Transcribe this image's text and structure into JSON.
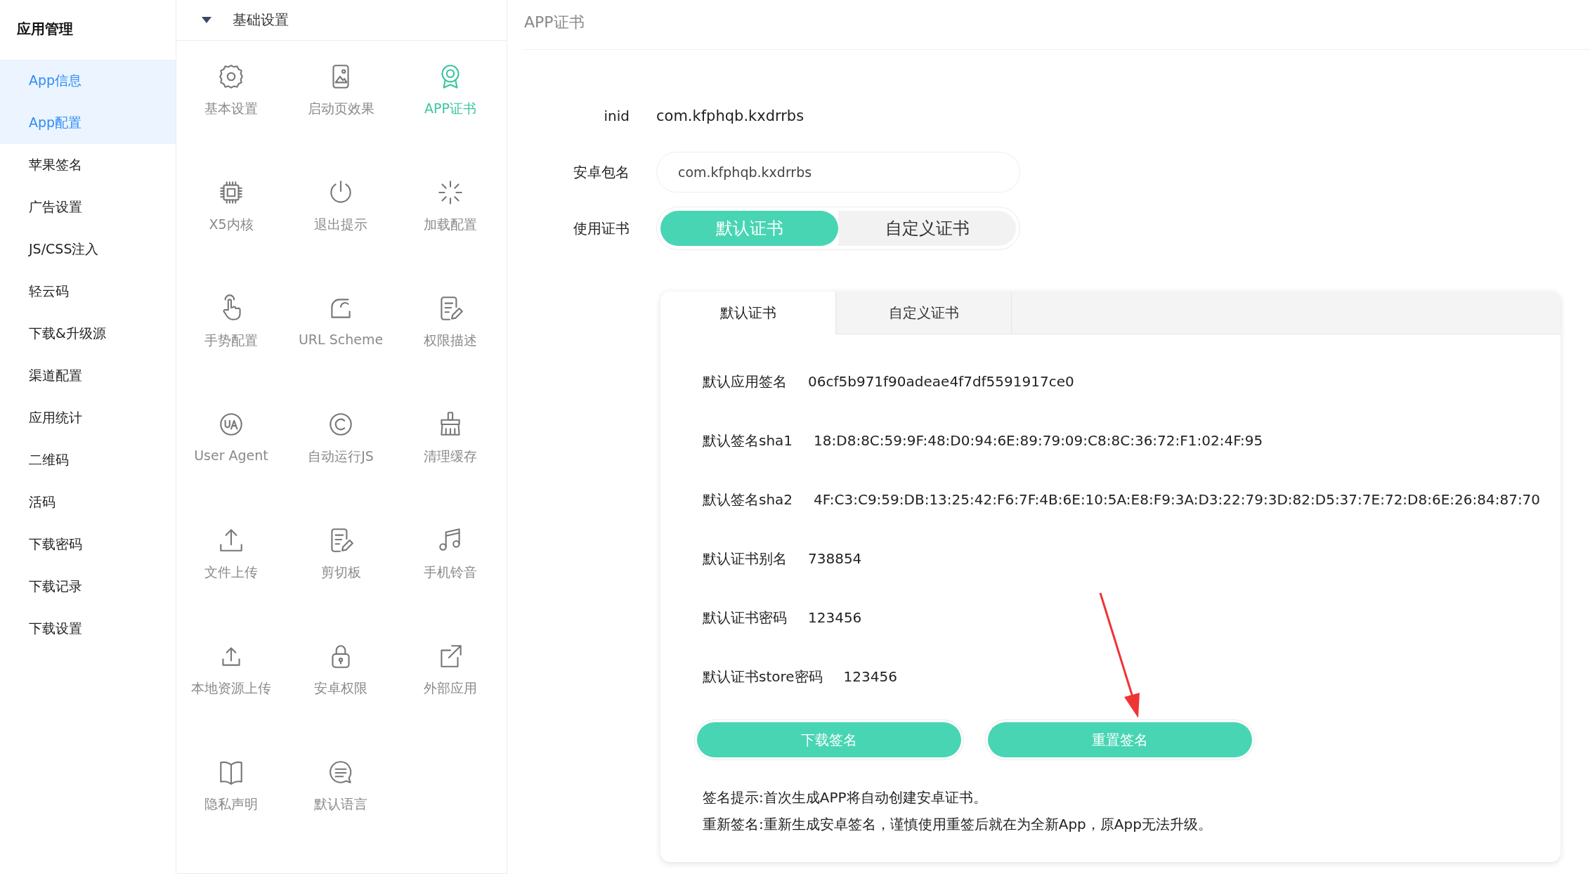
{
  "sidebar": {
    "title": "应用管理",
    "items": [
      {
        "label": "App信息",
        "selected": true
      },
      {
        "label": "App配置",
        "selected": true
      },
      {
        "label": "苹果签名",
        "selected": false
      },
      {
        "label": "广告设置",
        "selected": false
      },
      {
        "label": "JS/CSS注入",
        "selected": false
      },
      {
        "label": "轻云码",
        "selected": false
      },
      {
        "label": "下载&升级源",
        "selected": false
      },
      {
        "label": "渠道配置",
        "selected": false
      },
      {
        "label": "应用统计",
        "selected": false
      },
      {
        "label": "二维码",
        "selected": false
      },
      {
        "label": "活码",
        "selected": false
      },
      {
        "label": "下载密码",
        "selected": false
      },
      {
        "label": "下载记录",
        "selected": false
      },
      {
        "label": "下载设置",
        "selected": false
      }
    ]
  },
  "features": {
    "title": "基础设置",
    "expanded": true,
    "items": [
      {
        "label": "基本设置",
        "selected": false
      },
      {
        "label": "启动页效果",
        "selected": false
      },
      {
        "label": "APP证书",
        "selected": true
      },
      {
        "label": "X5内核",
        "selected": false
      },
      {
        "label": "退出提示",
        "selected": false
      },
      {
        "label": "加载配置",
        "selected": false
      },
      {
        "label": "手势配置",
        "selected": false
      },
      {
        "label": "URL Scheme",
        "selected": false
      },
      {
        "label": "权限描述",
        "selected": false
      },
      {
        "label": "User Agent",
        "selected": false
      },
      {
        "label": "自动运行JS",
        "selected": false
      },
      {
        "label": "清理缓存",
        "selected": false
      },
      {
        "label": "文件上传",
        "selected": false
      },
      {
        "label": "剪切板",
        "selected": false
      },
      {
        "label": "手机铃音",
        "selected": false
      },
      {
        "label": "本地资源上传",
        "selected": false
      },
      {
        "label": "安卓权限",
        "selected": false
      },
      {
        "label": "外部应用",
        "selected": false
      },
      {
        "label": "隐私声明",
        "selected": false
      },
      {
        "label": "默认语言",
        "selected": false
      }
    ]
  },
  "main": {
    "title": "APP证书",
    "inid": {
      "label": "inid",
      "value": "com.kfphqb.kxdrrbs"
    },
    "package": {
      "label": "安卓包名",
      "value": "com.kfphqb.kxdrrbs"
    },
    "certificate": {
      "label": "使用证书",
      "options": [
        {
          "label": "默认证书",
          "selected": true
        },
        {
          "label": "自定义证书",
          "selected": false
        }
      ]
    },
    "card": {
      "tabs": [
        {
          "label": "默认证书",
          "selected": true
        },
        {
          "label": "自定义证书",
          "selected": false
        }
      ],
      "rows": [
        {
          "label": "默认应用签名",
          "value": "06cf5b971f90adeae4f7df5591917ce0"
        },
        {
          "label": "默认签名sha1",
          "value": "18:D8:8C:59:9F:48:D0:94:6E:89:79:09:C8:8C:36:72:F1:02:4F:95"
        },
        {
          "label": "默认签名sha2",
          "value": "4F:C3:C9:59:DB:13:25:42:F6:7F:4B:6E:10:5A:E8:F9:3A:D3:22:79:3D:82:D5:37:7E:72:D8:6E:26:84:87:70"
        },
        {
          "label": "默认证书别名",
          "value": "738854"
        },
        {
          "label": "默认证书密码",
          "value": "123456"
        },
        {
          "label": "默认证书store密码",
          "value": "123456"
        }
      ],
      "buttons": [
        "下载签名",
        "重置签名"
      ],
      "notes": [
        "签名提示:首次生成APP将自动创建安卓证书。",
        "重新签名:重新生成安卓签名，谨慎使用重签后就在为全新App，原App无法升级。"
      ]
    }
  }
}
